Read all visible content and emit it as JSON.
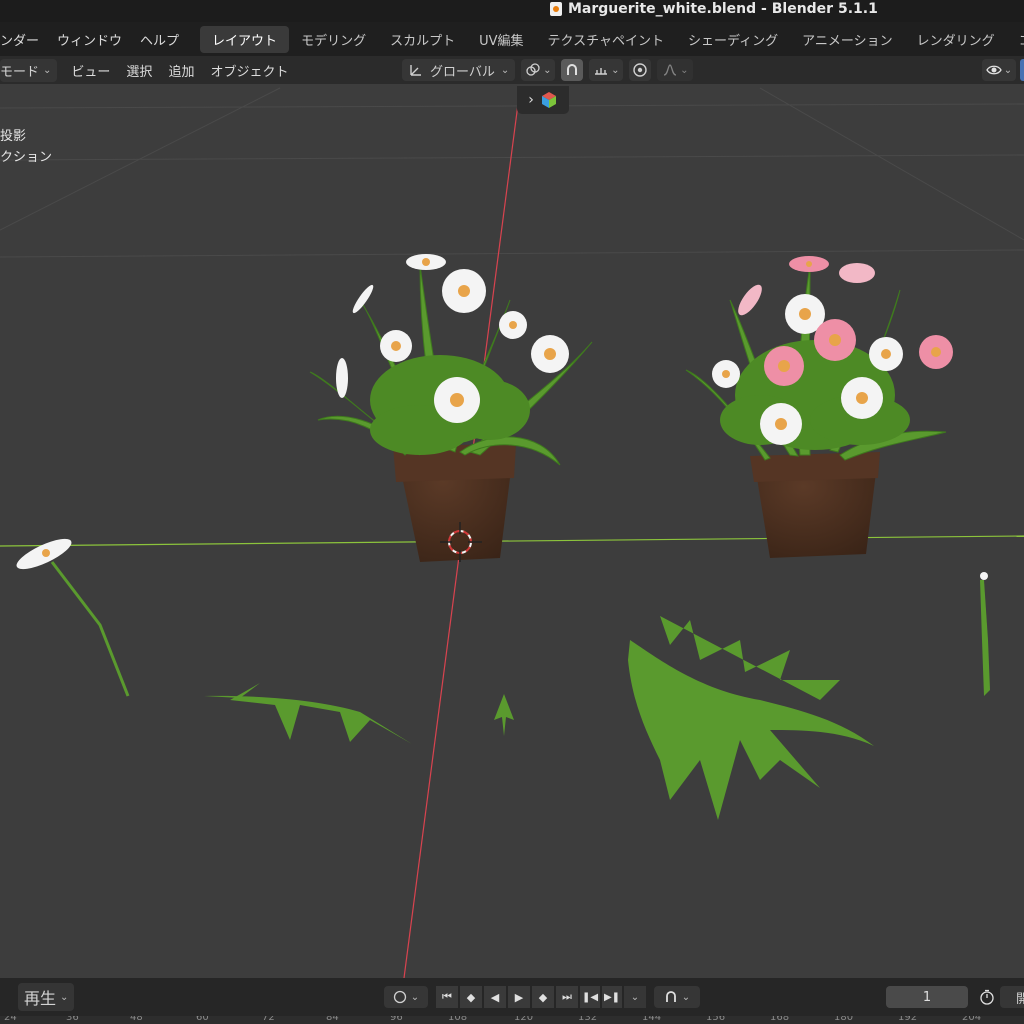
{
  "window": {
    "title": "Marguerite_white.blend - Blender 5.1.1"
  },
  "menubar": {
    "items": [
      "ンダー",
      "ウィンドウ",
      "ヘルプ"
    ],
    "workspaces": [
      "レイアウト",
      "モデリング",
      "スカルプト",
      "UV編集",
      "テクスチャペイント",
      "シェーディング",
      "アニメーション",
      "レンダリング",
      "コンポ"
    ],
    "active_workspace": "レイアウト"
  },
  "viewport_header": {
    "mode": "モード",
    "menus": [
      "ビュー",
      "選択",
      "追加",
      "オブジェクト"
    ],
    "transform_orientation": "グローバル"
  },
  "viewport": {
    "overlay_lines": [
      "投影",
      "クション"
    ]
  },
  "timeline": {
    "playback_label": "再生",
    "current_frame": "1",
    "clipped_label": "開",
    "ruler_ticks": [
      "24",
      "36",
      "48",
      "60",
      "72",
      "84",
      "96",
      "108",
      "120",
      "132",
      "144",
      "156",
      "168",
      "180",
      "192",
      "204"
    ]
  },
  "colors": {
    "x_axis": "#d9434f",
    "y_axis": "#8cc43c",
    "pot": "#4a2e1f",
    "leaf": "#5a9a2e",
    "petal_white": "#f4f4f4",
    "petal_pink": "#ee8fa6",
    "flower_center": "#e8a44a"
  },
  "icons": {
    "mode": "cursor-mode-icon",
    "orientation": "transform-orientation-icon",
    "pivot": "pivot-point-icon",
    "snap": "snap-magnet-icon",
    "increment": "snap-increment-icon",
    "proportional": "proportional-editing-icon",
    "falloff": "falloff-curve-icon",
    "visibility": "eye-icon",
    "gizmo": "gizmo-cube-icon",
    "keying": "keying-record-icon",
    "timer": "stopwatch-icon"
  }
}
